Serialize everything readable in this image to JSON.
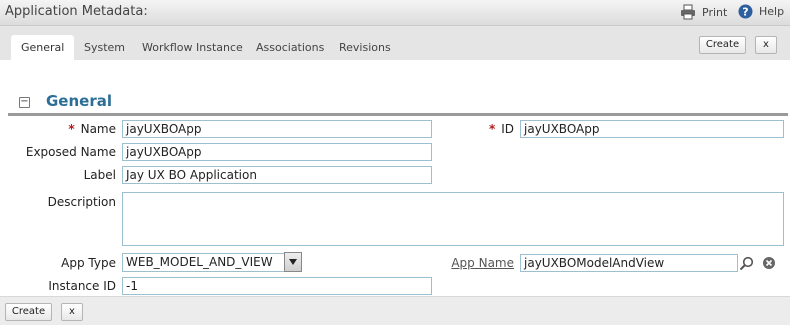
{
  "header": {
    "title": "Application Metadata:",
    "print_label": "Print",
    "help_label": "Help"
  },
  "tabs": [
    {
      "label": "General",
      "active": true
    },
    {
      "label": "System"
    },
    {
      "label": "Workflow Instance"
    },
    {
      "label": "Associations"
    },
    {
      "label": "Revisions"
    }
  ],
  "actions": {
    "create_label": "Create",
    "close_label": "x"
  },
  "section": {
    "collapse_glyph": "−",
    "title": "General"
  },
  "form": {
    "required_marker": "*",
    "name": {
      "label": "Name",
      "value": "jayUXBOApp",
      "required": true
    },
    "id": {
      "label": "ID",
      "value": "jayUXBOApp",
      "required": true
    },
    "exposed_name": {
      "label": "Exposed Name",
      "value": "jayUXBOApp"
    },
    "display_label": {
      "label": "Label",
      "value": "Jay UX BO Application"
    },
    "description": {
      "label": "Description",
      "value": ""
    },
    "app_type": {
      "label": "App Type",
      "value": "WEB_MODEL_AND_VIEW"
    },
    "app_name": {
      "label": "App Name",
      "value": "jayUXBOModelAndView"
    },
    "instance_id": {
      "label": "Instance ID",
      "value": "-1"
    }
  },
  "footer": {
    "create_label": "Create",
    "close_label": "x"
  },
  "colors": {
    "section_title": "#2b6e96",
    "required": "#b51a1a",
    "field_border": "#9dc0d0"
  }
}
